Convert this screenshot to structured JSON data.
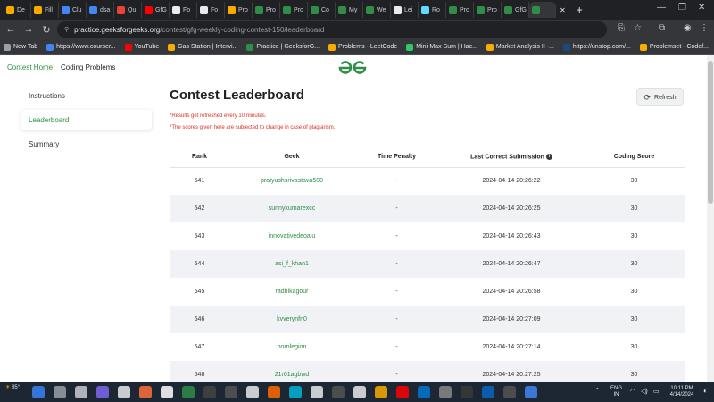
{
  "browser": {
    "tabs": [
      {
        "label": "De",
        "color": "#f9ab00"
      },
      {
        "label": "Fill",
        "color": "#f9ab00"
      },
      {
        "label": "Clu",
        "color": "#4285f4"
      },
      {
        "label": "dsa",
        "color": "#4285f4"
      },
      {
        "label": "Qu",
        "color": "#ea4335"
      },
      {
        "label": "GfG",
        "color": "#ff0000"
      },
      {
        "label": "Fo",
        "color": "#e8eaed"
      },
      {
        "label": "Fo",
        "color": "#e8eaed"
      },
      {
        "label": "Pro",
        "color": "#f9ab00"
      },
      {
        "label": "Pro",
        "color": "#2f8d46"
      },
      {
        "label": "Pro",
        "color": "#2f8d46"
      },
      {
        "label": "Co",
        "color": "#2f8d46"
      },
      {
        "label": "My",
        "color": "#2f8d46"
      },
      {
        "label": "We",
        "color": "#2f8d46"
      },
      {
        "label": "Lei",
        "color": "#e8eaed"
      },
      {
        "label": "Ro",
        "color": "#61dafb"
      },
      {
        "label": "Pro",
        "color": "#2f8d46"
      },
      {
        "label": "Pro",
        "color": "#2f8d46"
      },
      {
        "label": "GfG",
        "color": "#2f8d46"
      }
    ],
    "active_tab_label": "",
    "url_domain": "practice.geeksforgeeks.org",
    "url_path": "/contest/gfg-weekly-coding-contest-150/leaderboard",
    "bookmarks": [
      {
        "label": "New Tab",
        "color": "#9aa0a6"
      },
      {
        "label": "https://www.courser...",
        "color": "#4285f4"
      },
      {
        "label": "YouTube",
        "color": "#ff0000"
      },
      {
        "label": "Gas Station | Intervi...",
        "color": "#f9ab00"
      },
      {
        "label": "Practice | GeeksforG...",
        "color": "#2f8d46"
      },
      {
        "label": "Problems - LeetCode",
        "color": "#f9ab00"
      },
      {
        "label": "Mini-Max Sum | Hac...",
        "color": "#2ec866"
      },
      {
        "label": "Market Analysis II -...",
        "color": "#f9ab00"
      },
      {
        "label": "https://unstop.com/...",
        "color": "#1c4980"
      },
      {
        "label": "Problemset - Codef...",
        "color": "#f9ab00"
      }
    ]
  },
  "site": {
    "nav": {
      "contest_home": "Contest Home",
      "coding_problems": "Coding Problems"
    },
    "brand_color": "#2f8d46",
    "sidebar": [
      "Instructions",
      "Leaderboard",
      "Summary"
    ],
    "title": "Contest Leaderboard",
    "refresh_label": "Refresh",
    "notes": [
      "*Results get refreshed every 10 minutes.",
      "*The scores given here are subjected to change in case of plagiarism."
    ],
    "table": {
      "headers": [
        "Rank",
        "Geek",
        "Time Penalty",
        "Last Correct Submission",
        "Coding Score"
      ],
      "rows": [
        [
          "541",
          "pratyushsrivastava500",
          "-",
          "2024-04-14 20:26:22",
          "30"
        ],
        [
          "542",
          "sunnykumarexcc",
          "-",
          "2024-04-14 20:26:25",
          "30"
        ],
        [
          "543",
          "innovativedeoaju",
          "-",
          "2024-04-14 20:26:43",
          "30"
        ],
        [
          "544",
          "asi_f_khan1",
          "-",
          "2024-04-14 20:26:47",
          "30"
        ],
        [
          "545",
          "radhikagour",
          "-",
          "2024-04-14 20:26:58",
          "30"
        ],
        [
          "546",
          "kvverynfn0",
          "-",
          "2024-04-14 20:27:09",
          "30"
        ],
        [
          "547",
          "bornlegion",
          "-",
          "2024-04-14 20:27:14",
          "30"
        ],
        [
          "548",
          "21r01agbwd",
          "-",
          "2024-04-14 20:27:25",
          "30"
        ]
      ]
    }
  },
  "taskbar": {
    "weather_temp": "85°",
    "lang_line1": "ENG",
    "lang_line2": "IN",
    "time": "10:11 PM",
    "date": "4/14/2024"
  }
}
